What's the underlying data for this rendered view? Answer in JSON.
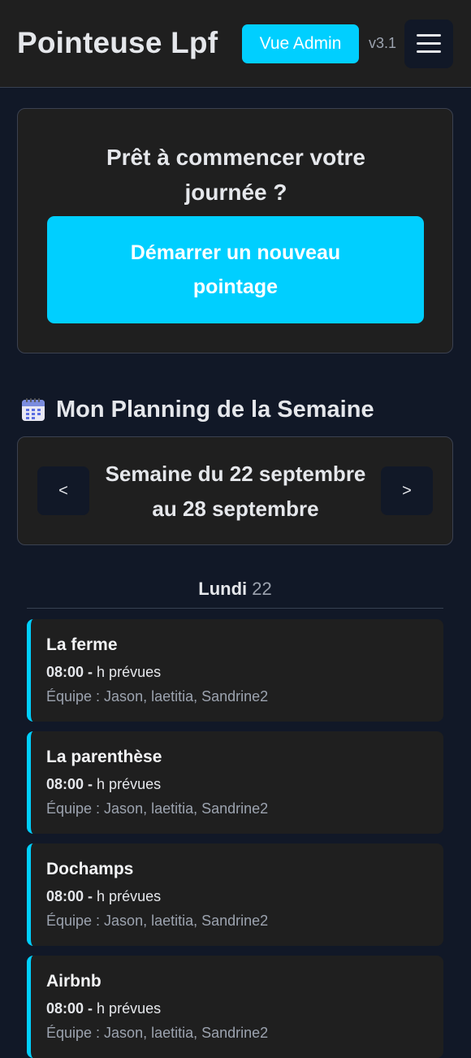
{
  "header": {
    "title": "Pointeuse Lpf",
    "admin_label": "Vue Admin",
    "version": "v3.1",
    "menu_icon": "hamburger-menu-icon"
  },
  "start": {
    "title": "Prêt à commencer votre journée ?",
    "button_label": "Démarrer un nouveau pointage"
  },
  "planning": {
    "icon": "calendar-icon",
    "title": "Mon Planning de la Semaine",
    "week_label": "Semaine du 22 septembre au 28 septembre",
    "prev_label": "<",
    "next_label": ">"
  },
  "day": {
    "name": "Lundi",
    "number": "22"
  },
  "tasks": [
    {
      "name": "La ferme",
      "time": "08:00",
      "time_sep": " - ",
      "hours": "h prévues",
      "team": "Équipe : Jason, laetitia, Sandrine2"
    },
    {
      "name": "La parenthèse",
      "time": "08:00",
      "time_sep": " - ",
      "hours": "h prévues",
      "team": "Équipe : Jason, laetitia, Sandrine2"
    },
    {
      "name": "Dochamps",
      "time": "08:00",
      "time_sep": " - ",
      "hours": "h prévues",
      "team": "Équipe : Jason, laetitia, Sandrine2"
    },
    {
      "name": "Airbnb",
      "time": "08:00",
      "time_sep": " - ",
      "hours": "h prévues",
      "team": "Équipe : Jason, laetitia, Sandrine2"
    }
  ],
  "colors": {
    "accent": "#00cfff",
    "background": "#111827",
    "card": "#1f1f1f"
  }
}
